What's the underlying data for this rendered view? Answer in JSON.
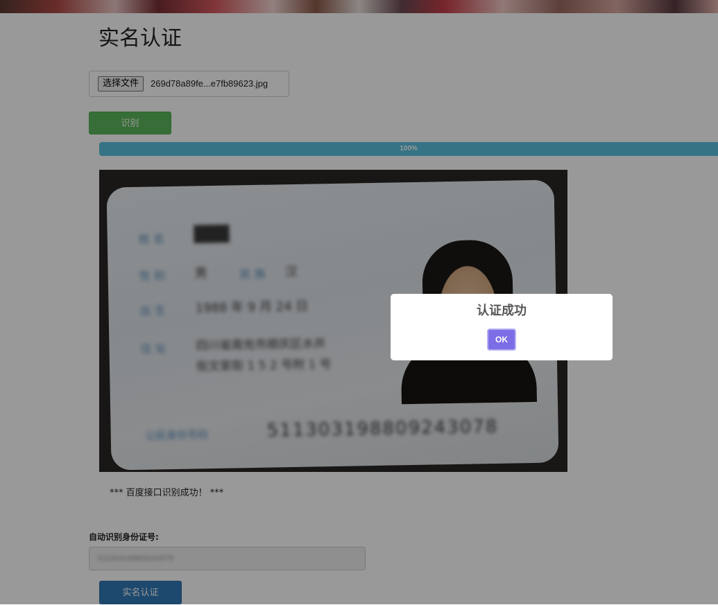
{
  "page": {
    "title": "实名认证"
  },
  "upload": {
    "choose_file_label": "选择文件",
    "file_name": "269d78a89fe...e7fb89623.jpg"
  },
  "recognize_button_label": "识别",
  "progress": {
    "value_percent": 100,
    "label": "100%"
  },
  "id_card_image": {
    "name_label": "姓 名",
    "gender_label": "性 别",
    "ethnicity_label": "民 族",
    "birth_label": "出 生",
    "address_label": "住 址",
    "id_number_label": "公民身份号码",
    "id_number": "511303198809243078"
  },
  "ocr_message": "*** 百度接口识别成功！ ***",
  "form": {
    "id_label": "自动识别身份证号:",
    "id_value": "511303198809243078",
    "submit_label": "实名认证"
  },
  "modal": {
    "title": "认证成功",
    "ok_label": "OK",
    "accent_color": "#7c6ee6"
  }
}
